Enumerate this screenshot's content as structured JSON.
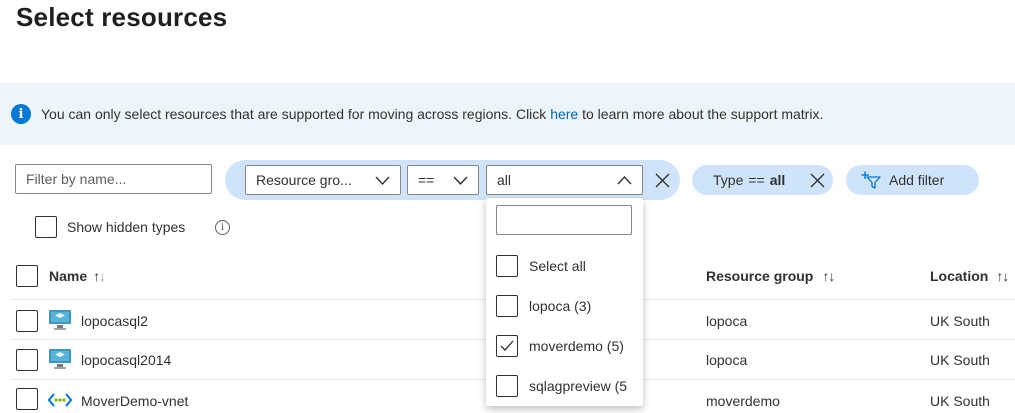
{
  "page": {
    "title": "Select resources"
  },
  "info": {
    "text_before": "You can only select resources that are supported for moving across regions. Click ",
    "link": "here",
    "text_after": " to learn more about the support matrix."
  },
  "filters": {
    "name_placeholder": "Filter by name...",
    "field_select": "Resource gro...",
    "operator_select": "==",
    "value_select": "all",
    "type_pill": {
      "label": "Type",
      "operator": "==",
      "value": "all"
    },
    "add_filter_label": "Add filter"
  },
  "show_hidden": {
    "label": "Show hidden types",
    "checked": false
  },
  "table": {
    "columns": {
      "name": "Name",
      "resource_group": "Resource group",
      "location": "Location"
    },
    "rows": [
      {
        "name": "lopocasql2",
        "icon": "sql-vm-icon",
        "resource_group": "lopoca",
        "location": "UK South"
      },
      {
        "name": "lopocasql2014",
        "icon": "sql-vm-icon",
        "resource_group": "lopoca",
        "location": "UK South"
      },
      {
        "name": "MoverDemo-vnet",
        "icon": "vnet-icon",
        "resource_group": "moverdemo",
        "location": "UK South"
      }
    ]
  },
  "value_dropdown": {
    "search_value": "",
    "options": [
      {
        "label": "Select all",
        "checked": false
      },
      {
        "label": "lopoca (3)",
        "checked": false
      },
      {
        "label": "moverdemo (5)",
        "checked": true
      },
      {
        "label": "sqlagpreview (5",
        "checked": false
      }
    ]
  },
  "colors": {
    "accent": "#0078d4",
    "pill_bg": "#cfe4fa",
    "info_bg": "#eef4fb",
    "link": "#0067b8"
  }
}
